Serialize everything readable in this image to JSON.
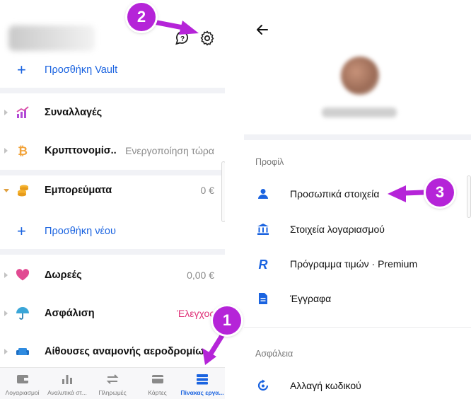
{
  "left": {
    "add_vault": "Προσθήκη Vault",
    "rows": [
      {
        "title": "Συναλλαγές",
        "value": ""
      },
      {
        "title": "Κρυπτονομίσ...",
        "value": "Ενεργοποίηση τώρα"
      },
      {
        "title": "Εμπορεύματα",
        "value": "0 €"
      },
      {
        "title": "Δωρεές",
        "value": "0,00 €"
      },
      {
        "title": "Ασφάλιση",
        "value": "Έλεγχος"
      },
      {
        "title": "Αίθουσες αναμονής αεροδρομίω...",
        "value": ""
      }
    ],
    "add_new": "Προσθήκη νέου",
    "nav": [
      {
        "label": "Λογαριασμοί",
        "icon": "wallet-icon"
      },
      {
        "label": "Αναλυτικά στ...",
        "icon": "analytics-icon"
      },
      {
        "label": "Πληρωμές",
        "icon": "payments-icon"
      },
      {
        "label": "Κάρτες",
        "icon": "card-icon"
      },
      {
        "label": "Πίνακας εργα...",
        "icon": "dashboard-icon"
      }
    ]
  },
  "right": {
    "profile_section": "Προφίλ",
    "profile_items": [
      {
        "label": "Προσωπικά στοιχεία",
        "icon": "person-icon"
      },
      {
        "label": "Στοιχεία λογαριασμού",
        "icon": "bank-icon"
      },
      {
        "label": "Πρόγραμμα τιμών · Premium",
        "icon": "revolut-r-icon"
      },
      {
        "label": "Έγγραφα",
        "icon": "document-icon"
      }
    ],
    "security_section": "Ασφάλεια",
    "security_items": [
      {
        "label": "Αλλαγή κωδικού",
        "icon": "passcode-icon"
      }
    ]
  },
  "callouts": [
    "1",
    "2",
    "3"
  ],
  "colors": {
    "accent": "#1a63e0",
    "callout": "#b524d8",
    "check_pink": "#e0357a"
  }
}
